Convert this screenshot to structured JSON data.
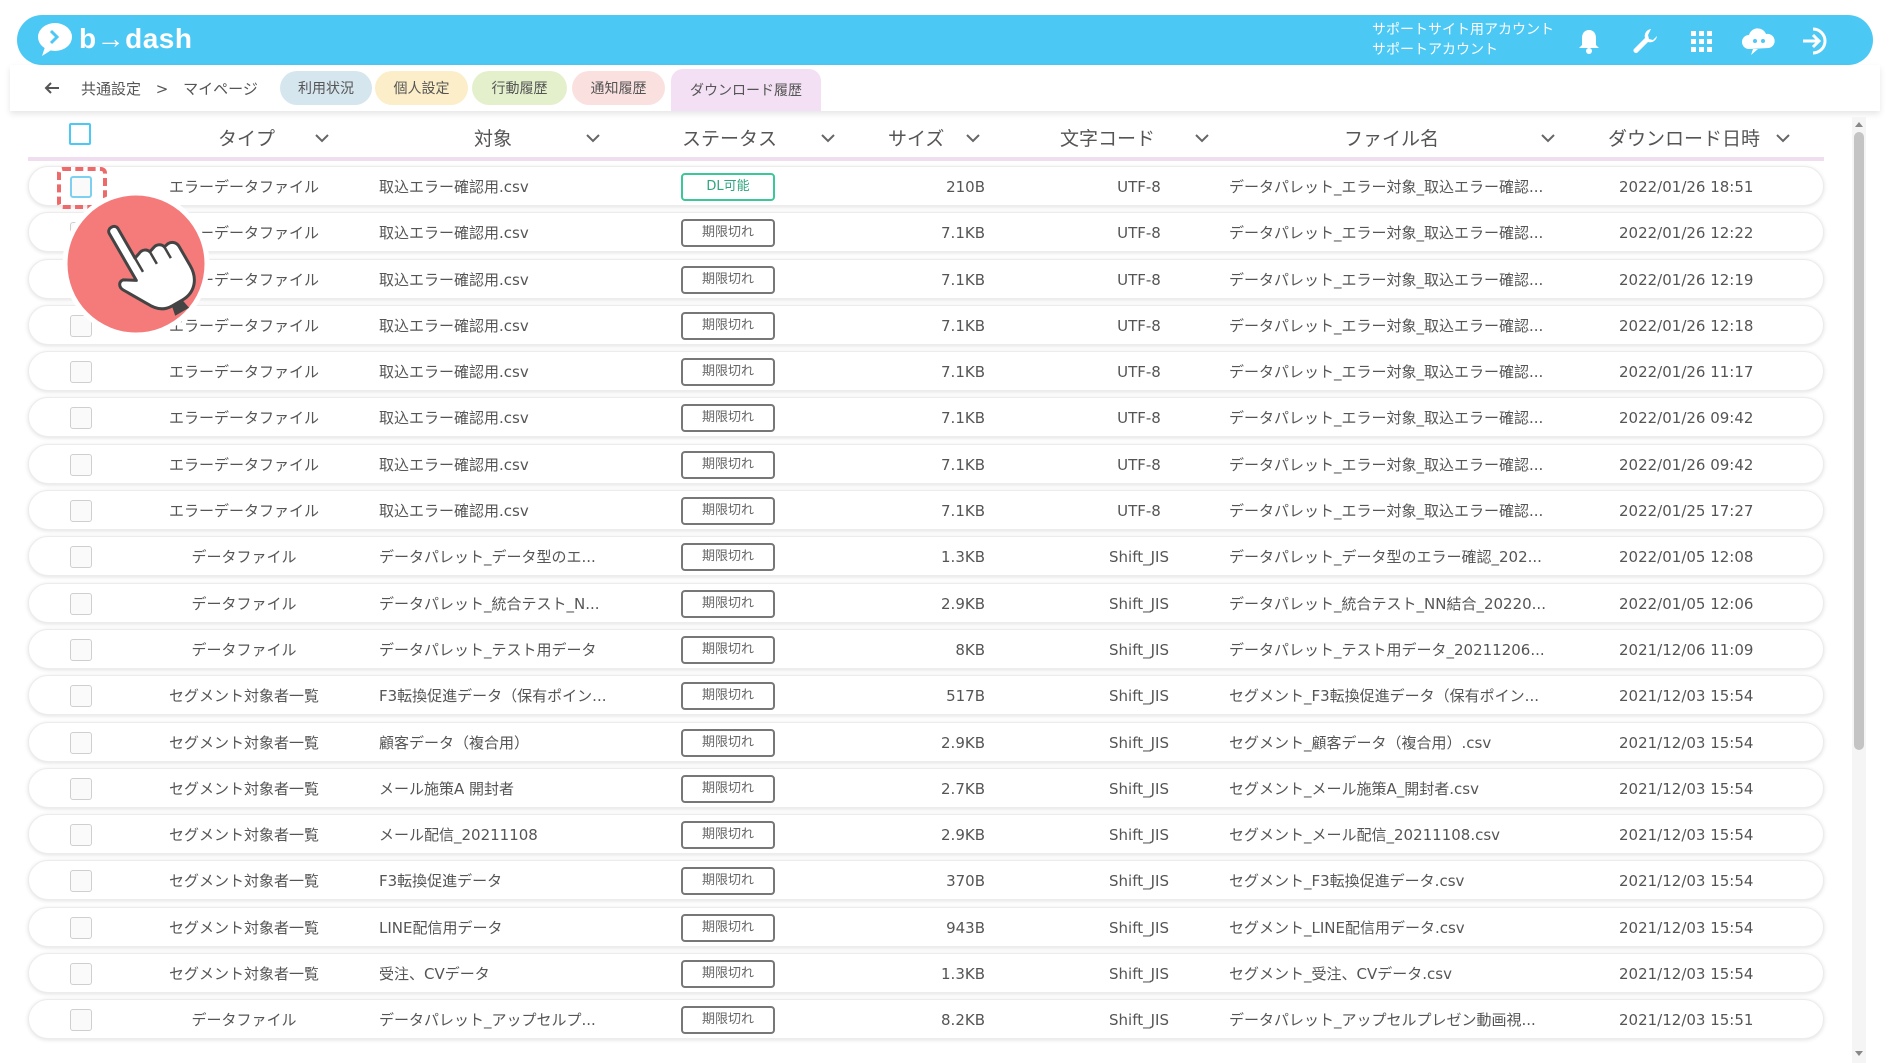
{
  "header": {
    "logo_text": "b→dash",
    "account_line1": "サポートサイト用アカウント",
    "account_line2": "サポートアカウント",
    "icons": [
      "bell-icon",
      "wrench-icon",
      "grid-icon",
      "support-cloud-icon",
      "logout-icon"
    ]
  },
  "breadcrumb": {
    "root": "共通設定",
    "sep": ">",
    "current": "マイページ"
  },
  "tabs": [
    {
      "label": "利用状況",
      "color": "#d6e6ee"
    },
    {
      "label": "個人設定",
      "color": "#fbeec8"
    },
    {
      "label": "行動履歴",
      "color": "#e4f0cc"
    },
    {
      "label": "通知履歴",
      "color": "#fbe0e0"
    },
    {
      "label": "ダウンロード履歴",
      "color": "#f4e0f4"
    }
  ],
  "columns": {
    "type": "タイプ",
    "target": "対象",
    "status": "ステータス",
    "size": "サイズ",
    "encoding": "文字コード",
    "filename": "ファイル名",
    "date": "ダウンロード日時"
  },
  "rows": [
    {
      "type": "エラーデータファイル",
      "target": "取込エラー確認用.csv",
      "status": "DL可能",
      "ok": true,
      "size": "210B",
      "enc": "UTF-8",
      "file": "データパレット_エラー対象_取込エラー確認...",
      "date": "2022/01/26 18:51"
    },
    {
      "type": "エラーデータファイル",
      "target": "取込エラー確認用.csv",
      "status": "期限切れ",
      "size": "7.1KB",
      "enc": "UTF-8",
      "file": "データパレット_エラー対象_取込エラー確認...",
      "date": "2022/01/26 12:22"
    },
    {
      "type": "エラーデータファイル",
      "target": "取込エラー確認用.csv",
      "status": "期限切れ",
      "size": "7.1KB",
      "enc": "UTF-8",
      "file": "データパレット_エラー対象_取込エラー確認...",
      "date": "2022/01/26 12:19"
    },
    {
      "type": "エラーデータファイル",
      "target": "取込エラー確認用.csv",
      "status": "期限切れ",
      "size": "7.1KB",
      "enc": "UTF-8",
      "file": "データパレット_エラー対象_取込エラー確認...",
      "date": "2022/01/26 12:18"
    },
    {
      "type": "エラーデータファイル",
      "target": "取込エラー確認用.csv",
      "status": "期限切れ",
      "size": "7.1KB",
      "enc": "UTF-8",
      "file": "データパレット_エラー対象_取込エラー確認...",
      "date": "2022/01/26 11:17"
    },
    {
      "type": "エラーデータファイル",
      "target": "取込エラー確認用.csv",
      "status": "期限切れ",
      "size": "7.1KB",
      "enc": "UTF-8",
      "file": "データパレット_エラー対象_取込エラー確認...",
      "date": "2022/01/26 09:42"
    },
    {
      "type": "エラーデータファイル",
      "target": "取込エラー確認用.csv",
      "status": "期限切れ",
      "size": "7.1KB",
      "enc": "UTF-8",
      "file": "データパレット_エラー対象_取込エラー確認...",
      "date": "2022/01/26 09:42"
    },
    {
      "type": "エラーデータファイル",
      "target": "取込エラー確認用.csv",
      "status": "期限切れ",
      "size": "7.1KB",
      "enc": "UTF-8",
      "file": "データパレット_エラー対象_取込エラー確認...",
      "date": "2022/01/25 17:27"
    },
    {
      "type": "データファイル",
      "target": "データパレット_データ型のエ...",
      "status": "期限切れ",
      "size": "1.3KB",
      "enc": "Shift_JIS",
      "file": "データパレット_データ型のエラー確認_202...",
      "date": "2022/01/05 12:08"
    },
    {
      "type": "データファイル",
      "target": "データパレット_統合テスト_N...",
      "status": "期限切れ",
      "size": "2.9KB",
      "enc": "Shift_JIS",
      "file": "データパレット_統合テスト_NN結合_20220...",
      "date": "2022/01/05 12:06"
    },
    {
      "type": "データファイル",
      "target": "データパレット_テスト用データ",
      "status": "期限切れ",
      "size": "8KB",
      "enc": "Shift_JIS",
      "file": "データパレット_テスト用データ_20211206...",
      "date": "2021/12/06 11:09"
    },
    {
      "type": "セグメント対象者一覧",
      "target": "F3転換促進データ（保有ポイン...",
      "status": "期限切れ",
      "size": "517B",
      "enc": "Shift_JIS",
      "file": "セグメント_F3転換促進データ（保有ポイン...",
      "date": "2021/12/03 15:54"
    },
    {
      "type": "セグメント対象者一覧",
      "target": "顧客データ（複合用）",
      "status": "期限切れ",
      "size": "2.9KB",
      "enc": "Shift_JIS",
      "file": "セグメント_顧客データ（複合用）.csv",
      "date": "2021/12/03 15:54"
    },
    {
      "type": "セグメント対象者一覧",
      "target": "メール施策A 開封者",
      "status": "期限切れ",
      "size": "2.7KB",
      "enc": "Shift_JIS",
      "file": "セグメント_メール施策A_開封者.csv",
      "date": "2021/12/03 15:54"
    },
    {
      "type": "セグメント対象者一覧",
      "target": "メール配信_20211108",
      "status": "期限切れ",
      "size": "2.9KB",
      "enc": "Shift_JIS",
      "file": "セグメント_メール配信_20211108.csv",
      "date": "2021/12/03 15:54"
    },
    {
      "type": "セグメント対象者一覧",
      "target": "F3転換促進データ",
      "status": "期限切れ",
      "size": "370B",
      "enc": "Shift_JIS",
      "file": "セグメント_F3転換促進データ.csv",
      "date": "2021/12/03 15:54"
    },
    {
      "type": "セグメント対象者一覧",
      "target": "LINE配信用データ",
      "status": "期限切れ",
      "size": "943B",
      "enc": "Shift_JIS",
      "file": "セグメント_LINE配信用データ.csv",
      "date": "2021/12/03 15:54"
    },
    {
      "type": "セグメント対象者一覧",
      "target": "受注、CVデータ",
      "status": "期限切れ",
      "size": "1.3KB",
      "enc": "Shift_JIS",
      "file": "セグメント_受注、CVデータ.csv",
      "date": "2021/12/03 15:54"
    },
    {
      "type": "データファイル",
      "target": "データパレット_アップセルプ...",
      "status": "期限切れ",
      "size": "8.2KB",
      "enc": "Shift_JIS",
      "file": "データパレット_アップセルプレゼン動画視...",
      "date": "2021/12/03 15:51"
    }
  ],
  "colors": {
    "header_bg": "#4cc8f5",
    "ok_border": "#3cc79a",
    "focus": "#ee6a6a",
    "pointer_bg": "#f57b7b"
  }
}
